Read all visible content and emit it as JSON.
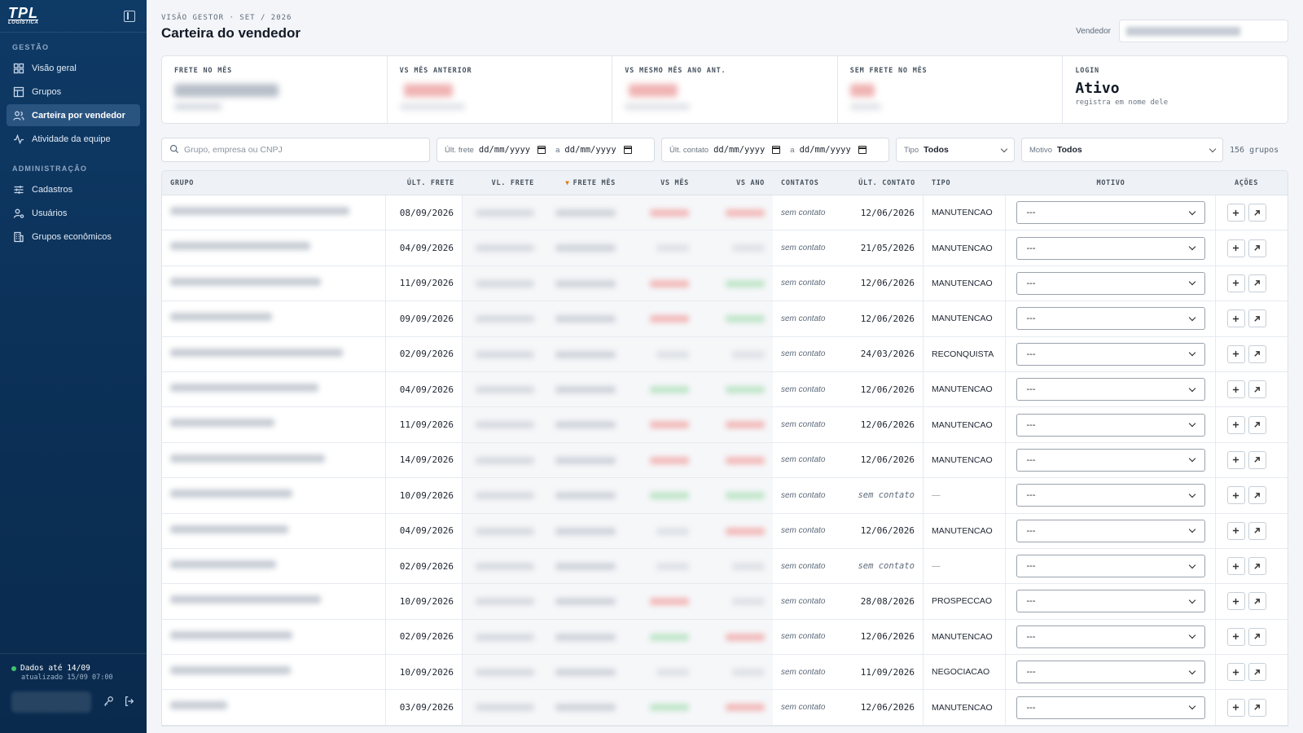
{
  "sidebar": {
    "logo_main": "TPL",
    "logo_sub": "LOGÍSTICA",
    "section_gestao": "GESTÃO",
    "section_admin": "ADMINISTRAÇÃO",
    "gestao_items": [
      {
        "label": "Visão geral",
        "icon": "grid-icon"
      },
      {
        "label": "Grupos",
        "icon": "table-icon"
      },
      {
        "label": "Carteira por vendedor",
        "icon": "users-icon",
        "active": true
      },
      {
        "label": "Atividade da equipe",
        "icon": "activity-icon"
      }
    ],
    "admin_items": [
      {
        "label": "Cadastros",
        "icon": "sliders-icon"
      },
      {
        "label": "Usuários",
        "icon": "user-gear-icon"
      },
      {
        "label": "Grupos econômicos",
        "icon": "building-icon"
      }
    ],
    "status": "Dados até 14/09",
    "updated": "atualizado 15/09 07:00"
  },
  "header": {
    "breadcrumb": "VISÃO GESTOR · SET / 2026",
    "title": "Carteira do vendedor",
    "seller_label": "Vendedor"
  },
  "kpis": [
    {
      "label": "FRETE NO MÊS"
    },
    {
      "label": "VS MÊS ANTERIOR"
    },
    {
      "label": "VS MESMO MÊS ANO ANT."
    },
    {
      "label": "SEM FRETE NO MÊS"
    },
    {
      "label": "LOGIN",
      "value": "Ativo",
      "sub": "registra em nome dele"
    }
  ],
  "filters": {
    "search_placeholder": "Grupo, empresa ou CNPJ",
    "ult_frete_label": "Últ. frete",
    "ult_contato_label": "Últ. contato",
    "date_placeholder": "dd/mm/yyyy",
    "range_sep": "a",
    "tipo_label": "Tipo",
    "tipo_value": "Todos",
    "motivo_label": "Motivo",
    "motivo_value": "Todos",
    "count": "156 grupos"
  },
  "table": {
    "columns": [
      "GRUPO",
      "ÚLT. FRETE",
      "VL. FRETE",
      "FRETE MÊS",
      "VS MÊS",
      "VS ANO",
      "CONTATOS",
      "ÚLT. CONTATO",
      "TIPO",
      "MOTIVO",
      "AÇÕES"
    ],
    "sort_indicator": "▼",
    "contatos_text": "sem contato",
    "motivo_default": "---",
    "rows": [
      {
        "ult_frete": "08/09/2026",
        "ult_contato": "12/06/2026",
        "tipo": "MANUTENCAO",
        "vs_mes": "red",
        "vs_ano": "red"
      },
      {
        "ult_frete": "04/09/2026",
        "ult_contato": "21/05/2026",
        "tipo": "MANUTENCAO",
        "vs_mes": "gray",
        "vs_ano": "gray"
      },
      {
        "ult_frete": "11/09/2026",
        "ult_contato": "12/06/2026",
        "tipo": "MANUTENCAO",
        "vs_mes": "red",
        "vs_ano": "green"
      },
      {
        "ult_frete": "09/09/2026",
        "ult_contato": "12/06/2026",
        "tipo": "MANUTENCAO",
        "vs_mes": "red",
        "vs_ano": "green"
      },
      {
        "ult_frete": "02/09/2026",
        "ult_contato": "24/03/2026",
        "tipo": "RECONQUISTA",
        "vs_mes": "gray",
        "vs_ano": "gray"
      },
      {
        "ult_frete": "04/09/2026",
        "ult_contato": "12/06/2026",
        "tipo": "MANUTENCAO",
        "vs_mes": "green",
        "vs_ano": "green"
      },
      {
        "ult_frete": "11/09/2026",
        "ult_contato": "12/06/2026",
        "tipo": "MANUTENCAO",
        "vs_mes": "red",
        "vs_ano": "red"
      },
      {
        "ult_frete": "14/09/2026",
        "ult_contato": "12/06/2026",
        "tipo": "MANUTENCAO",
        "vs_mes": "red",
        "vs_ano": "red"
      },
      {
        "ult_frete": "10/09/2026",
        "ult_contato": "sem contato",
        "tipo": "—",
        "vs_mes": "green",
        "vs_ano": "green"
      },
      {
        "ult_frete": "04/09/2026",
        "ult_contato": "12/06/2026",
        "tipo": "MANUTENCAO",
        "vs_mes": "gray",
        "vs_ano": "red"
      },
      {
        "ult_frete": "02/09/2026",
        "ult_contato": "sem contato",
        "tipo": "—",
        "vs_mes": "gray",
        "vs_ano": "gray"
      },
      {
        "ult_frete": "10/09/2026",
        "ult_contato": "28/08/2026",
        "tipo": "PROSPECCAO",
        "vs_mes": "red",
        "vs_ano": "gray"
      },
      {
        "ult_frete": "02/09/2026",
        "ult_contato": "12/06/2026",
        "tipo": "MANUTENCAO",
        "vs_mes": "green",
        "vs_ano": "red"
      },
      {
        "ult_frete": "10/09/2026",
        "ult_contato": "11/09/2026",
        "tipo": "NEGOCIACAO",
        "vs_mes": "gray",
        "vs_ano": "gray"
      },
      {
        "ult_frete": "03/09/2026",
        "ult_contato": "12/06/2026",
        "tipo": "MANUTENCAO",
        "vs_mes": "green",
        "vs_ano": "red"
      }
    ]
  },
  "colors": {
    "sidebar_bg": "#0e3a66",
    "accent_sort": "#e07b16",
    "positive": "#3ec46d",
    "negative": "#e05a5a"
  }
}
